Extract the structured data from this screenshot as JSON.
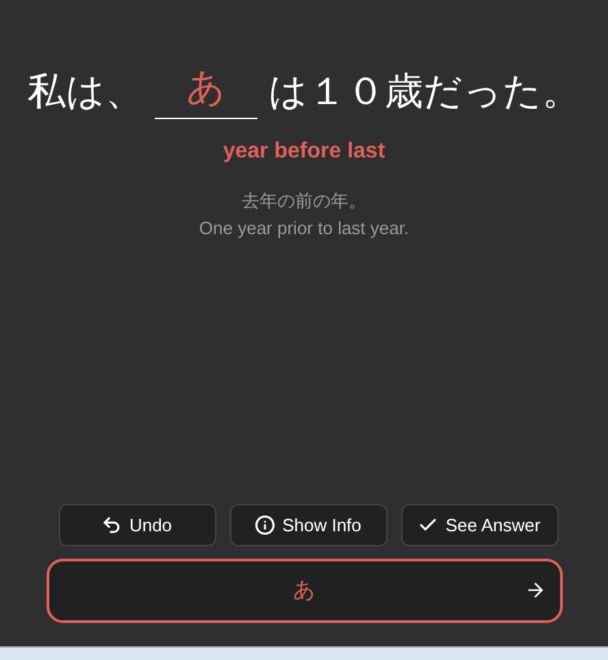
{
  "sentence": {
    "before": "私は、",
    "blank_answer": "あ",
    "after": "は１０歳だった。"
  },
  "meaning": "year before last",
  "definition_ja": "去年の前の年。",
  "definition_en": "One year prior to last year.",
  "buttons": [
    {
      "kind": "undo",
      "label": "Undo"
    },
    {
      "kind": "info",
      "label": "Show Info"
    },
    {
      "kind": "check",
      "label": "See Answer"
    }
  ],
  "answer_field": {
    "value": "あ"
  }
}
